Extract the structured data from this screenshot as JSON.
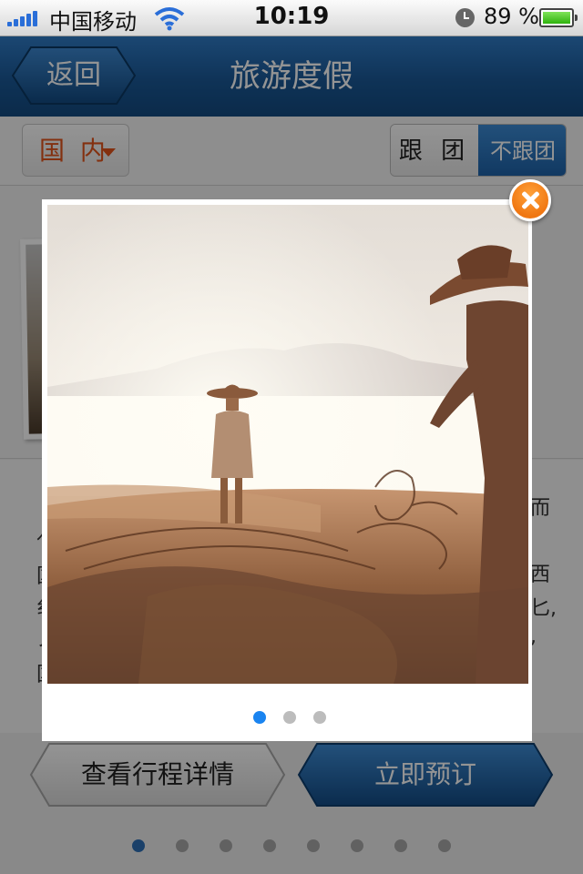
{
  "status_bar": {
    "carrier": "中国移动",
    "time": "10:19",
    "battery": "89 %"
  },
  "nav": {
    "back_label": "返回",
    "title": "旅游度假"
  },
  "filter": {
    "region_label": "国 内",
    "segment": [
      "跟 团",
      "不跟团"
    ],
    "selected_segment": 1
  },
  "description_fragments": {
    "left": [
      "亻",
      "国",
      "纟",
      "ノ",
      "国"
    ],
    "right": [
      "而",
      "西",
      "匕,",
      ","
    ]
  },
  "actions": {
    "itinerary_label": "查看行程详情",
    "book_label": "立即预订"
  },
  "pager": {
    "count": 8,
    "active": 0
  },
  "popup": {
    "photo_description_icon": "fishermen-beach-photo",
    "dots_count": 3,
    "dots_active": 0
  },
  "colors": {
    "accent_orange": "#e2541b",
    "nav_blue": "#1a5896",
    "dot_active": "#1a84f0"
  }
}
